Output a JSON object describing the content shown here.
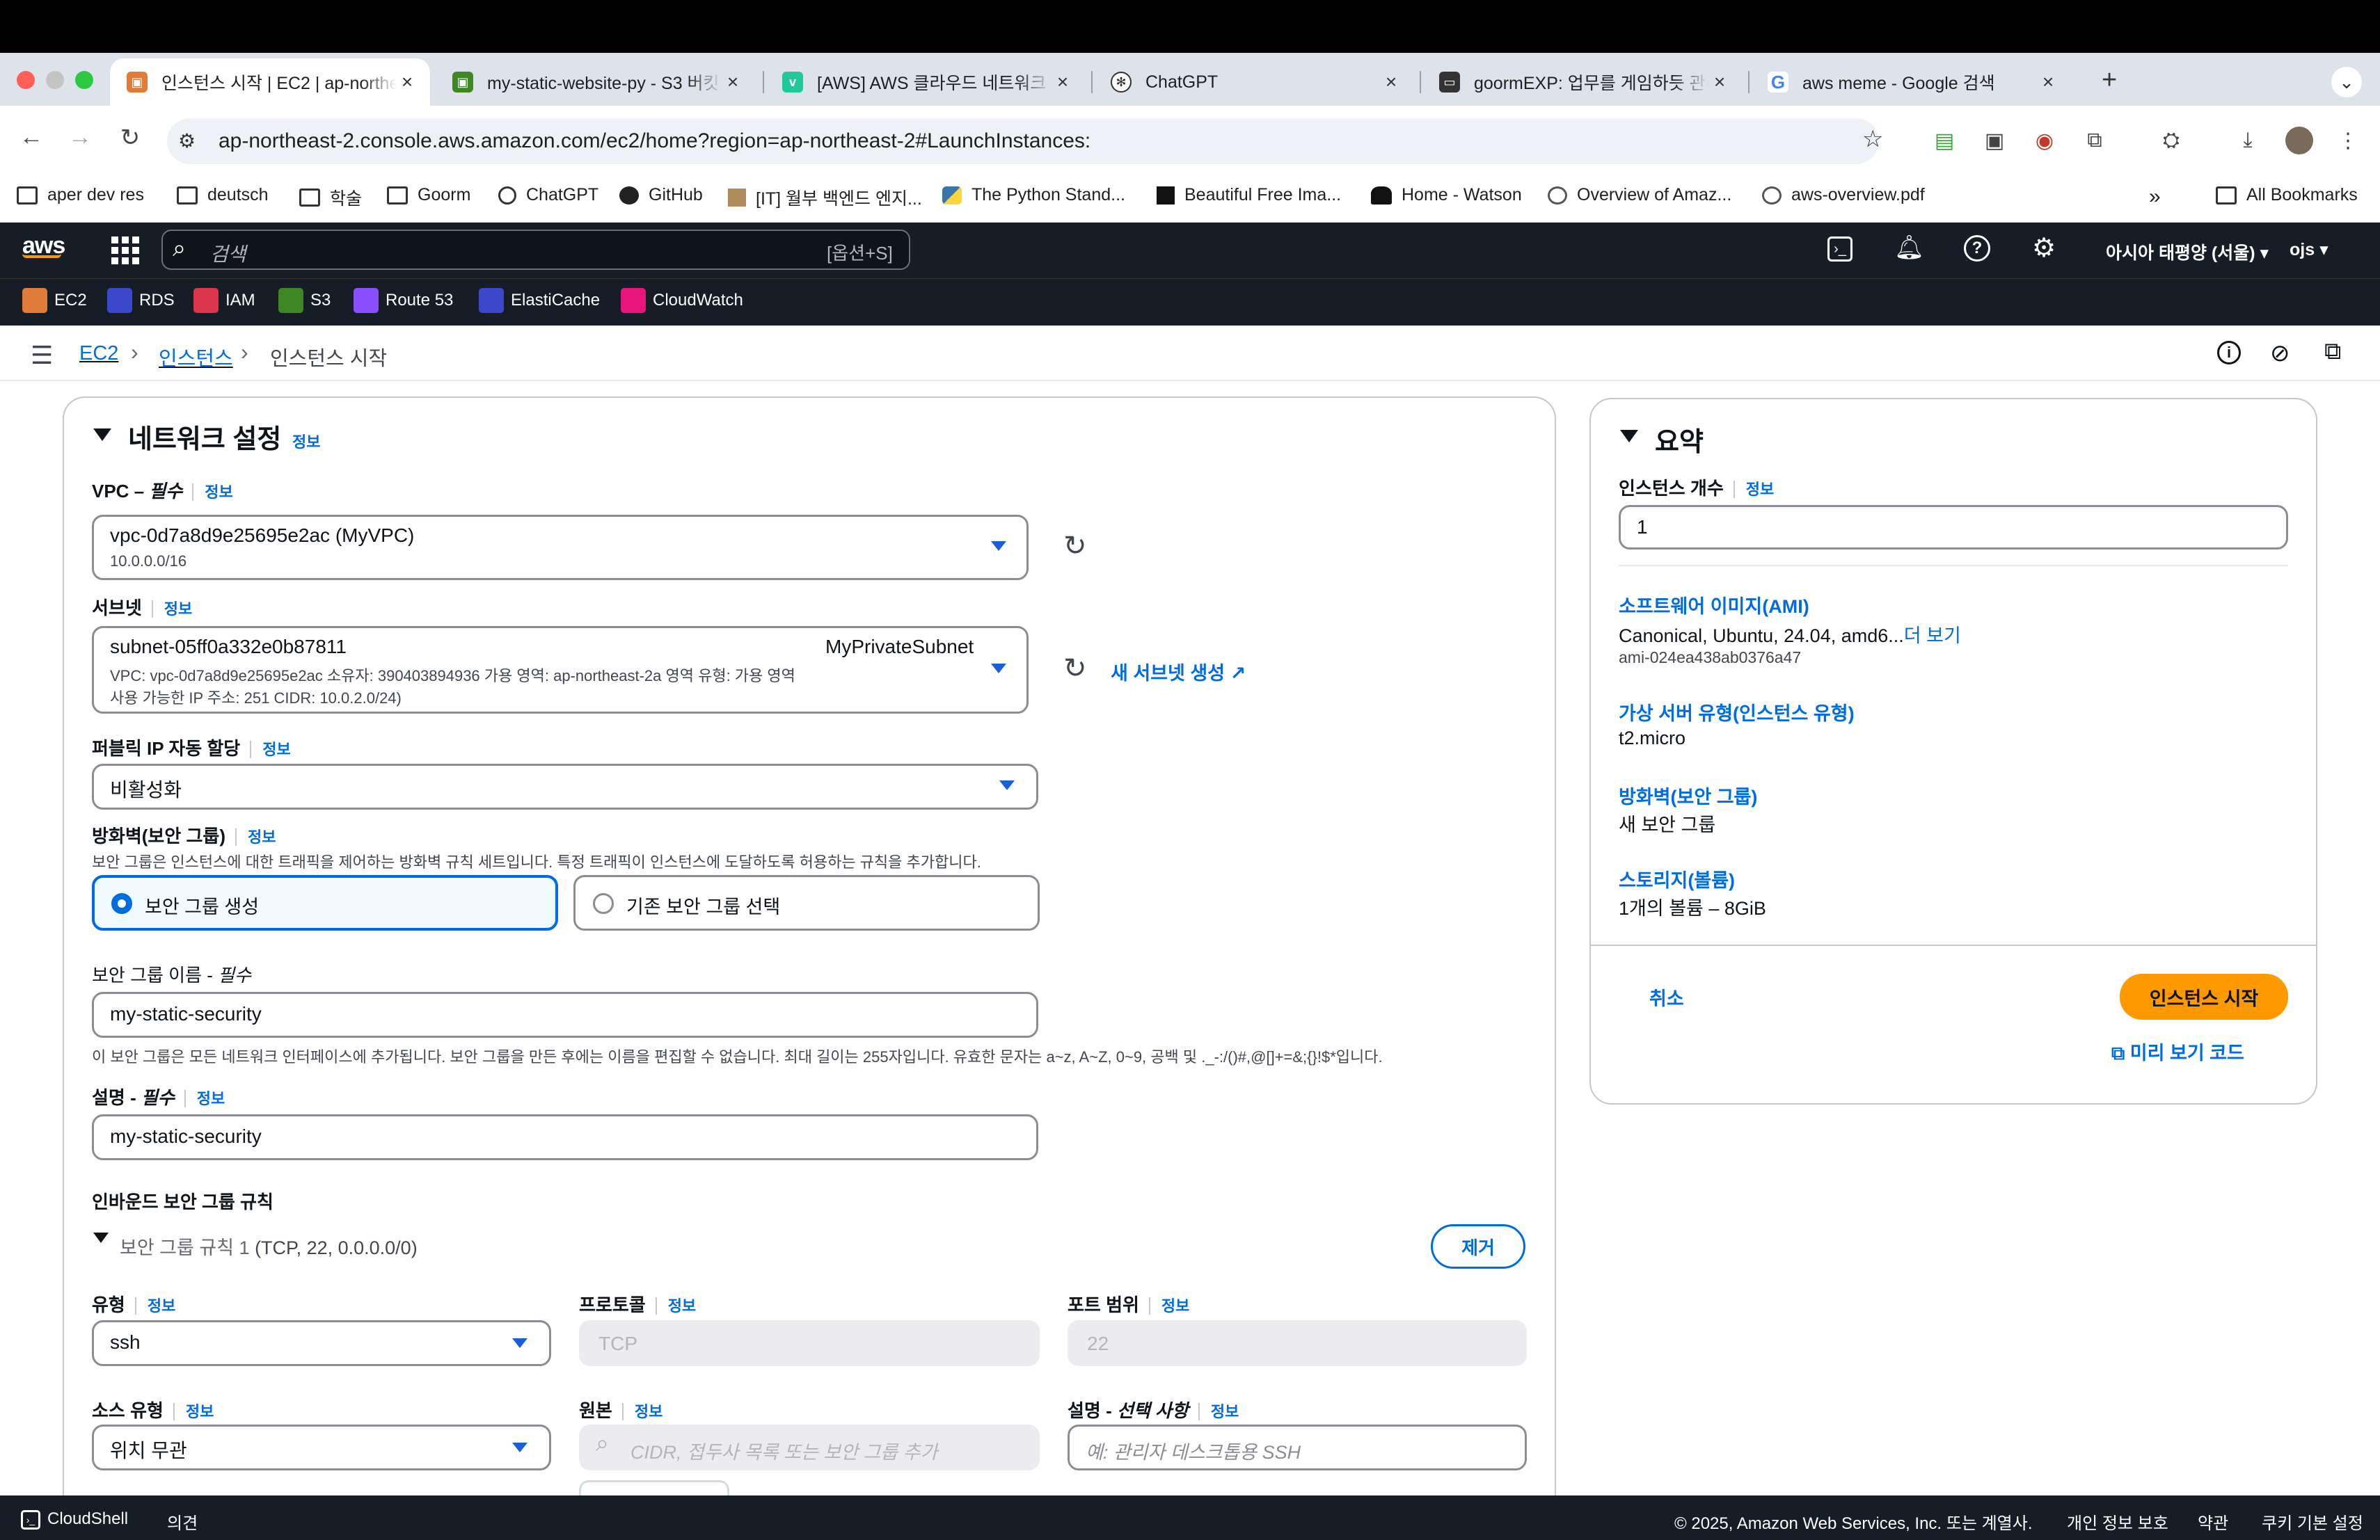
{
  "browser": {
    "tabs": [
      {
        "label": "인스턴스 시작 | EC2 | ap-northeast-2",
        "active": true
      },
      {
        "label": "my-static-website-py - S3 버킷",
        "active": false
      },
      {
        "label": "[AWS] AWS 클라우드 네트워크 구성",
        "active": false
      },
      {
        "label": "ChatGPT",
        "active": false
      },
      {
        "label": "goormEXP: 업무를 게임하듯 관리",
        "active": false
      },
      {
        "label": "aws meme - Google 검색",
        "active": false
      }
    ],
    "url": "ap-northeast-2.console.aws.amazon.com/ec2/home?region=ap-northeast-2#LaunchInstances:",
    "bookmarks": [
      "aper dev res",
      "deutsch",
      "학술",
      "Goorm",
      "ChatGPT",
      "GitHub",
      "[IT] 월부 백엔드 엔지...",
      "The Python Stand...",
      "Beautiful Free Ima...",
      "Home - Watson",
      "Overview of Amaz...",
      "aws-overview.pdf"
    ],
    "all_bookmarks": "All Bookmarks",
    "more": "»"
  },
  "aws_nav": {
    "search_placeholder": "검색",
    "search_shortcut": "[옵션+S]",
    "region": "아시아 태평양 (서울)",
    "user": "ojs",
    "services": [
      "EC2",
      "RDS",
      "IAM",
      "S3",
      "Route 53",
      "ElastiCache",
      "CloudWatch"
    ]
  },
  "breadcrumb": {
    "items": [
      "EC2",
      "인스턴스",
      "인스턴스 시작"
    ]
  },
  "network": {
    "title": "네트워크 설정",
    "info": "정보",
    "vpc_label": "VPC – ",
    "vpc_required": "필수",
    "vpc_value": "vpc-0d7a8d9e25695e2ac (MyVPC)",
    "vpc_cidr": "10.0.0.0/16",
    "subnet_label": "서브넷",
    "subnet_value": "subnet-05ff0a332e0b87811",
    "subnet_name": "MyPrivateSubnet",
    "subnet_line2": "VPC: vpc-0d7a8d9e25695e2ac    소유자: 390403894936    가용 영역: ap-northeast-2a    영역 유형: 가용 영역",
    "subnet_line3": "사용 가능한 IP 주소: 251    CIDR: 10.0.2.0/24)",
    "new_subnet": "새 서브넷 생성",
    "public_ip_label": "퍼블릭 IP 자동 할당",
    "public_ip_value": "비활성화",
    "firewall_label": "방화벽(보안 그룹)",
    "firewall_desc": "보안 그룹은 인스턴스에 대한 트래픽을 제어하는 방화벽 규칙 세트입니다. 특정 트래픽이 인스턴스에 도달하도록 허용하는 규칙을 추가합니다.",
    "radio_create": "보안 그룹 생성",
    "radio_existing": "기존 보안 그룹 선택",
    "sg_name_label": "보안 그룹 이름 - ",
    "sg_name_required": "필수",
    "sg_name_value": "my-static-security",
    "sg_name_hint": "이 보안 그룹은 모든 네트워크 인터페이스에 추가됩니다. 보안 그룹을 만든 후에는 이름을 편집할 수 없습니다. 최대 길이는 255자입니다. 유효한 문자는 a~z, A~Z, 0~9, 공백 및 ._-:/()#,@[]+=&;{}!$*입니다.",
    "desc_label": "설명 - ",
    "desc_required": "필수",
    "desc_value": "my-static-security",
    "inbound_title": "인바운드 보안 그룹 규칙",
    "rule_title": "보안 그룹 규칙 1",
    "rule_detail": " (TCP, 22, 0.0.0.0/0)",
    "remove": "제거",
    "type_label": "유형",
    "type_value": "ssh",
    "protocol_label": "프로토콜",
    "protocol_value": "TCP",
    "port_label": "포트 범위",
    "port_value": "22",
    "source_type_label": "소스 유형",
    "source_type_value": "위치 무관",
    "source_label": "원본",
    "source_placeholder": "CIDR, 접두사 목록 또는 보안 그룹 추가",
    "rule_desc_label": "설명 - ",
    "rule_desc_optional": "선택 사항",
    "rule_desc_placeholder": "예: 관리자 데스크톱용 SSH"
  },
  "summary": {
    "title": "요약",
    "count_label": "인스턴스 개수",
    "info": "정보",
    "count_value": "1",
    "ami_label": "소프트웨어 이미지(AMI)",
    "ami_value": "Canonical, Ubuntu, 24.04, amd6...",
    "ami_more": "더 보기",
    "ami_id": "ami-024ea438ab0376a47",
    "type_label": "가상 서버 유형(인스턴스 유형)",
    "type_value": "t2.micro",
    "fw_label": "방화벽(보안 그룹)",
    "fw_value": "새 보안 그룹",
    "storage_label": "스토리지(볼륨)",
    "storage_value": "1개의 볼륨 – 8GiB",
    "cancel": "취소",
    "launch": "인스턴스 시작",
    "preview": "미리 보기 코드"
  },
  "footer": {
    "cloudshell": "CloudShell",
    "feedback": "의견",
    "copyright": "© 2025, Amazon Web Services, Inc. 또는 계열사.",
    "privacy": "개인 정보 보호",
    "terms": "약관",
    "cookies": "쿠키 기본 설정"
  }
}
